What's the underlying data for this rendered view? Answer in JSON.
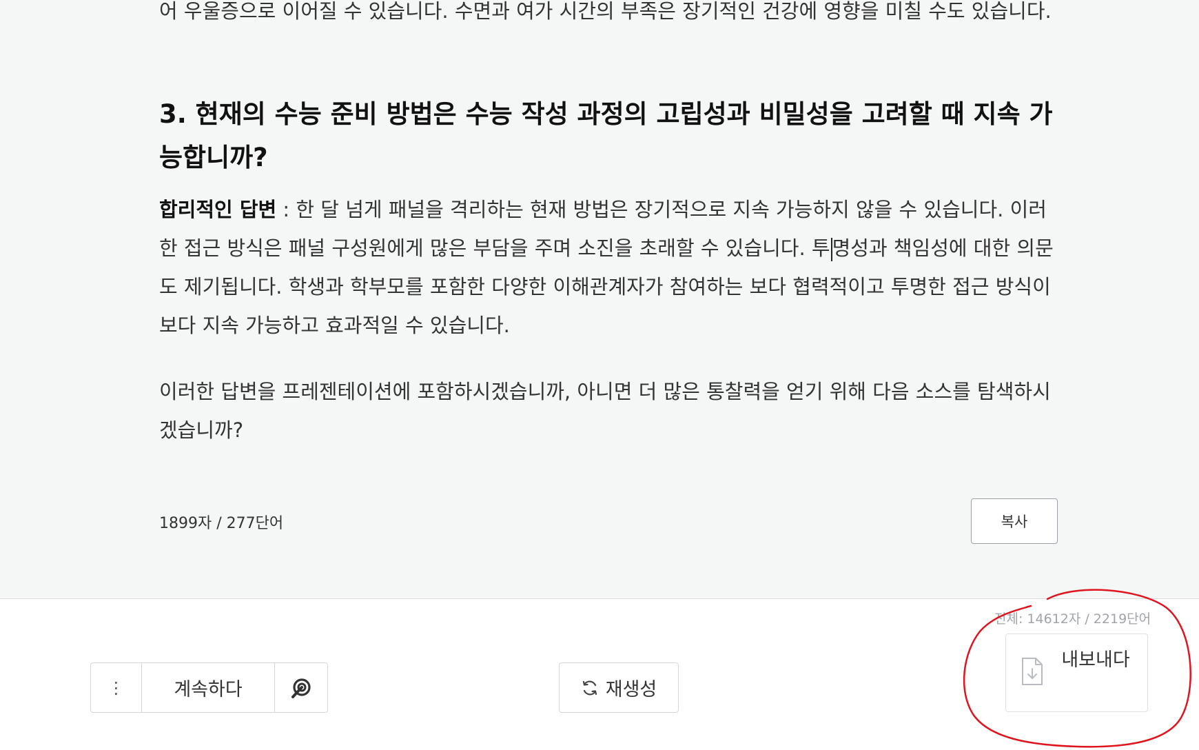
{
  "content": {
    "top_paragraph": "어 우울증으로 이어질 수 있습니다. 수면과 여가 시간의 부족은 장기적인 건강에 영향을 미칠 수도 있습니다.",
    "heading": "3. 현재의 수능 준비 방법은 수능 작성 과정의 고립성과 비밀성을 고려할 때 지속 가능합니까?",
    "answer_label": "합리적인 답변",
    "answer_text": " : 한 달 넘게 패널을 격리하는 현재 방법은 장기적으로 지속 가능하지 않을 수 있습니다. 이러한 접근 방식은 패널 구성원에게 많은 부담을 주며 소진을 초래할 수 있습니다. 투",
    "answer_text_2": "명성과 책임성에 대한 의문도 제기됩니다. 학생과 학부모를 포함한 다양한 이해관계자가 참여하는 보다 협력적이고 투명한 접근 방식이 보다 지속 가능하고 효과적일 수 있습니다.",
    "question": "이러한 답변을 프레젠테이션에 포함하시겠습니까, 아니면 더 많은 통찰력을 얻기 위해 다음 소스를 탐색하시겠습니까?",
    "count": "1899자 / 277단어",
    "copy_label": "복사"
  },
  "toolbar": {
    "more_label": "⋮",
    "continue_label": "계속하다",
    "regenerate_label": "재생성",
    "total_count": "전체: 14612자 / 2219단어",
    "export_label": "내보내다"
  },
  "icons": {
    "more": "more-vertical-icon",
    "wand": "magic-wand-icon",
    "regenerate": "refresh-icon",
    "export": "file-download-icon"
  },
  "colors": {
    "content_bg": "#f5f6f6",
    "annotation": "#e0141e"
  }
}
